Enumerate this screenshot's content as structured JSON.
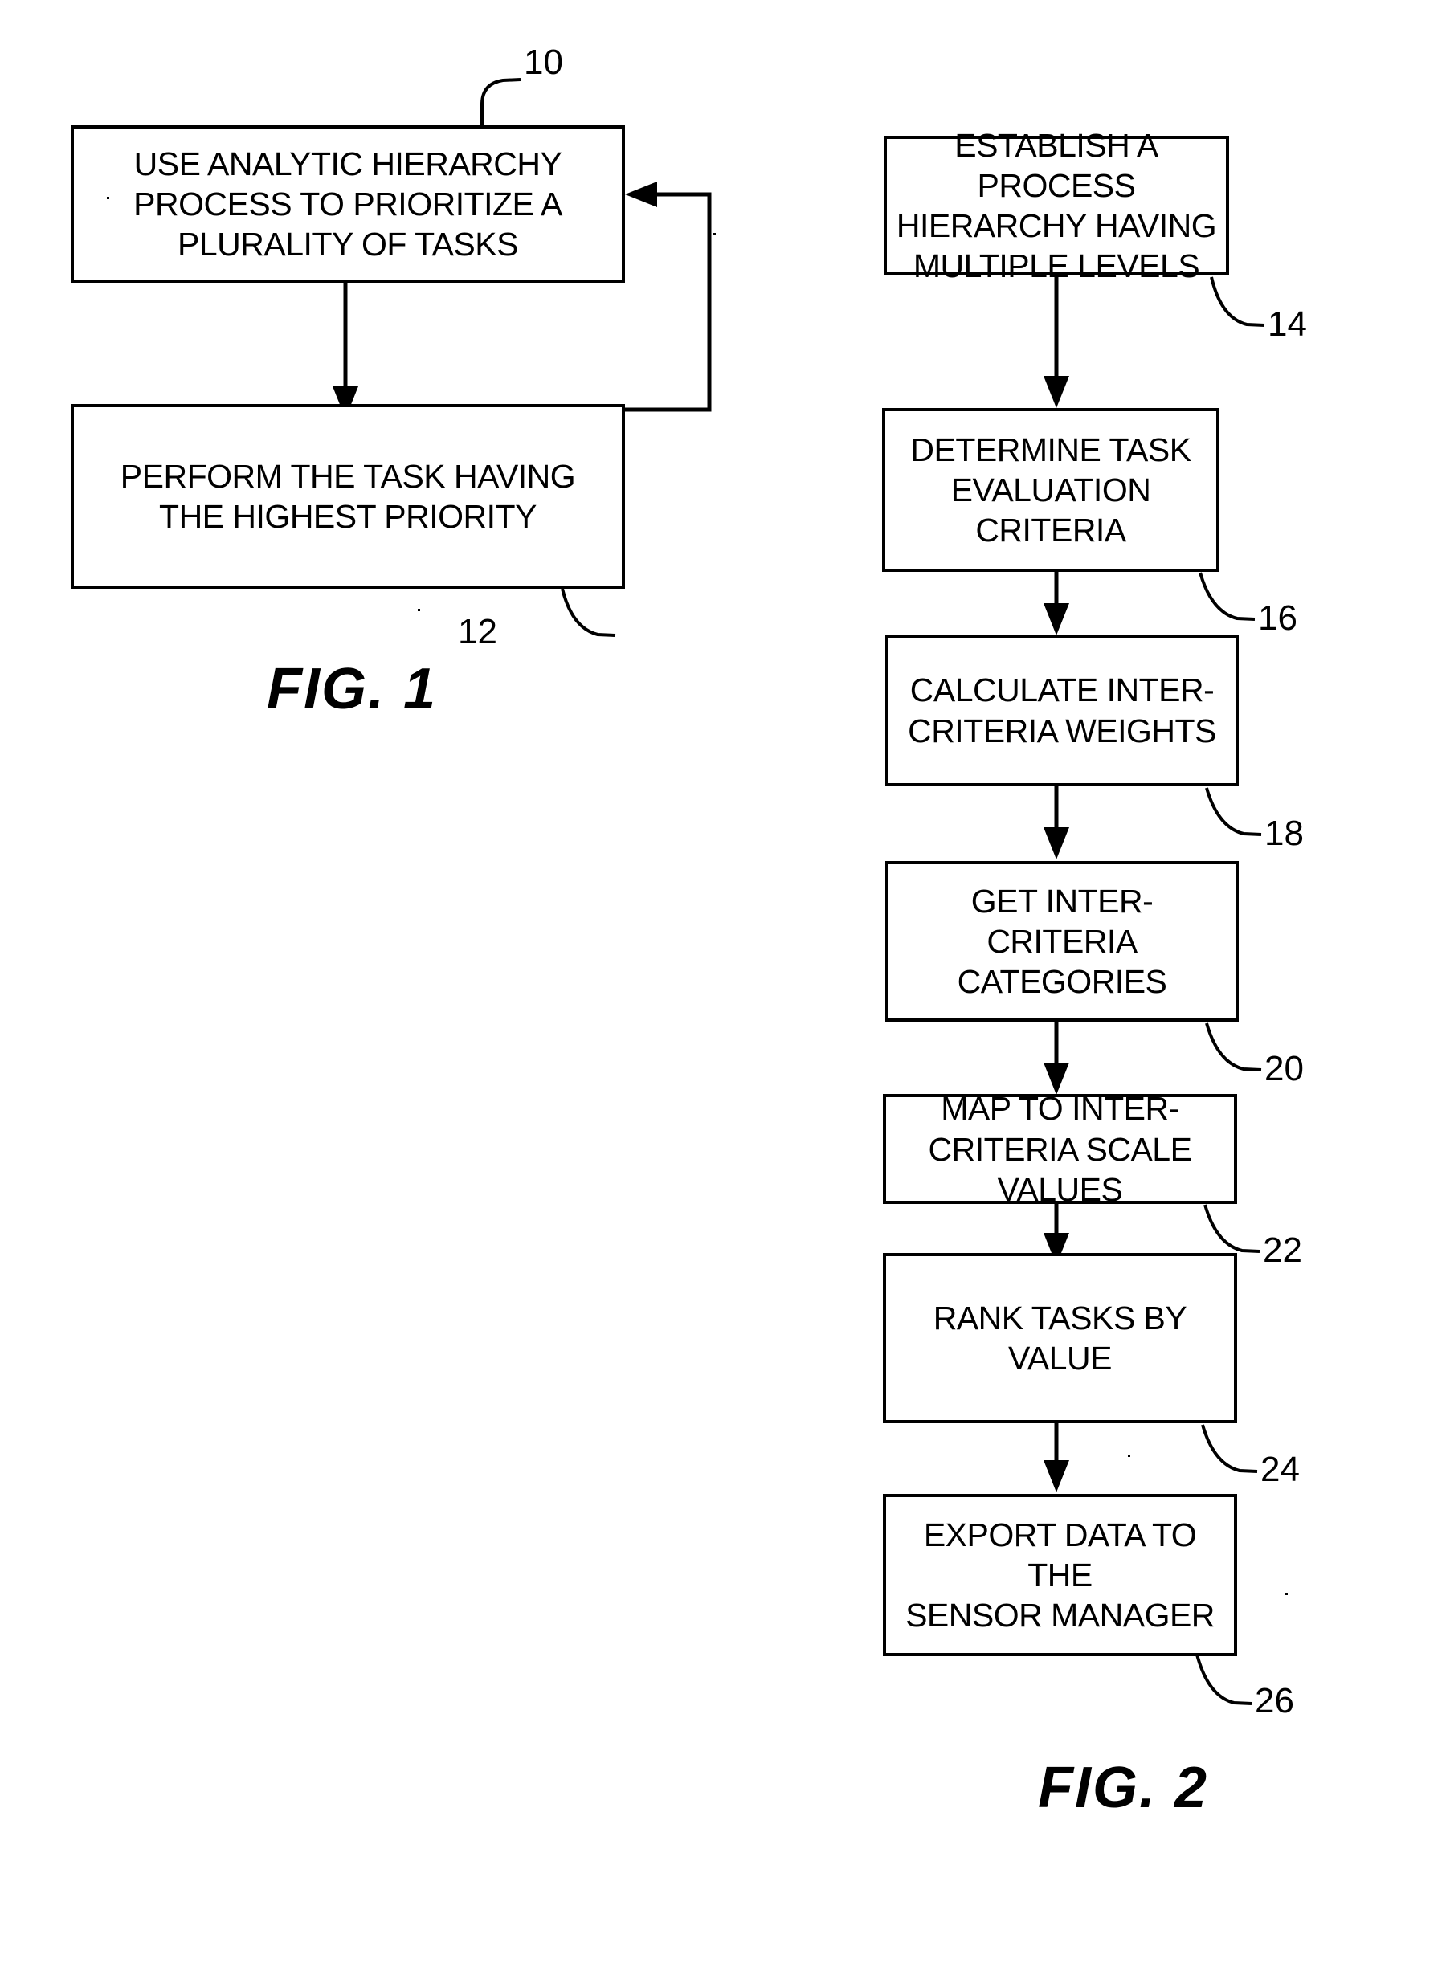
{
  "document": {
    "type": "patent-drawing-sheet",
    "figures": [
      {
        "id": "fig1",
        "caption": "FIG. 1",
        "boxes": [
          {
            "ref": "10",
            "text": "USE ANALYTIC HIERARCHY\nPROCESS TO PRIORITIZE A\nPLURALITY OF TASKS"
          },
          {
            "ref": "12",
            "text": "PERFORM THE TASK HAVING\nTHE HIGHEST PRIORITY"
          }
        ]
      },
      {
        "id": "fig2",
        "caption": "FIG. 2",
        "boxes": [
          {
            "ref": "14",
            "text": "ESTABLISH A PROCESS\nHIERARCHY HAVING\nMULTIPLE LEVELS"
          },
          {
            "ref": "16",
            "text": "DETERMINE TASK\nEVALUATION CRITERIA"
          },
          {
            "ref": "18",
            "text": "CALCULATE INTER-\nCRITERIA WEIGHTS"
          },
          {
            "ref": "20",
            "text": "GET INTER-CRITERIA\nCATEGORIES"
          },
          {
            "ref": "22",
            "text": "MAP TO INTER-\nCRITERIA SCALE VALUES"
          },
          {
            "ref": "24",
            "text": "RANK TASKS BY VALUE"
          },
          {
            "ref": "26",
            "text": "EXPORT DATA TO THE\nSENSOR MANAGER"
          }
        ]
      }
    ],
    "colors": {
      "ink": "#000000",
      "paper": "#ffffff"
    }
  }
}
